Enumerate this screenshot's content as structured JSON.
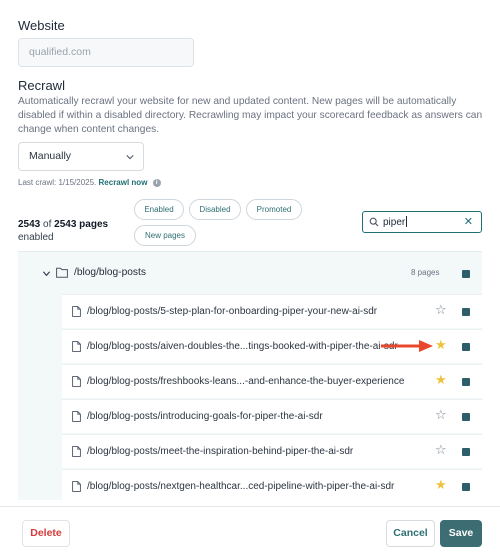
{
  "website": {
    "title": "Website",
    "url_value": "qualified.com"
  },
  "recrawl": {
    "title": "Recrawl",
    "description": "Automatically recrawl your website for new and updated content. New pages will be automatically disabled if within a disabled directory. Recrawling may impact your scorecard feedback as answers can change when content changes.",
    "frequency_selected": "Manually",
    "last_crawl_text": "Last crawl: 1/15/2025.",
    "recrawl_now_label": "Recrawl now",
    "info_icon": "i"
  },
  "pages": {
    "enabled_count": "2543",
    "of_text": "of",
    "total_count": "2543 pages",
    "enabled_label": "enabled"
  },
  "filters": [
    "Enabled",
    "Disabled",
    "Promoted",
    "New pages"
  ],
  "search": {
    "value": "piper",
    "clear_icon": "✕"
  },
  "folder": {
    "path": "/blog/blog-posts",
    "count": "8 pages"
  },
  "rows": [
    {
      "path": "/blog/blog-posts/5-step-plan-for-onboarding-piper-your-new-ai-sdr",
      "starred": false,
      "star": "☆"
    },
    {
      "path": "/blog/blog-posts/aiven-doubles-the...tings-booked-with-piper-the-ai-sdr",
      "starred": true,
      "star": "★"
    },
    {
      "path": "/blog/blog-posts/freshbooks-leans...-and-enhance-the-buyer-experience",
      "starred": true,
      "star": "★"
    },
    {
      "path": "/blog/blog-posts/introducing-goals-for-piper-the-ai-sdr",
      "starred": false,
      "star": "☆"
    },
    {
      "path": "/blog/blog-posts/meet-the-inspiration-behind-piper-the-ai-sdr",
      "starred": false,
      "star": "☆"
    },
    {
      "path": "/blog/blog-posts/nextgen-healthcar...ced-pipeline-with-piper-the-ai-sdr",
      "starred": true,
      "star": "★"
    }
  ],
  "footer": {
    "delete_label": "Delete",
    "cancel_label": "Cancel",
    "save_label": "Save"
  },
  "colors": {
    "accent": "#1f6f73",
    "primary_button": "#3b6d72",
    "danger": "#d63b3b",
    "star_on": "#f0c23b",
    "annotation_arrow": "#e8472b"
  }
}
